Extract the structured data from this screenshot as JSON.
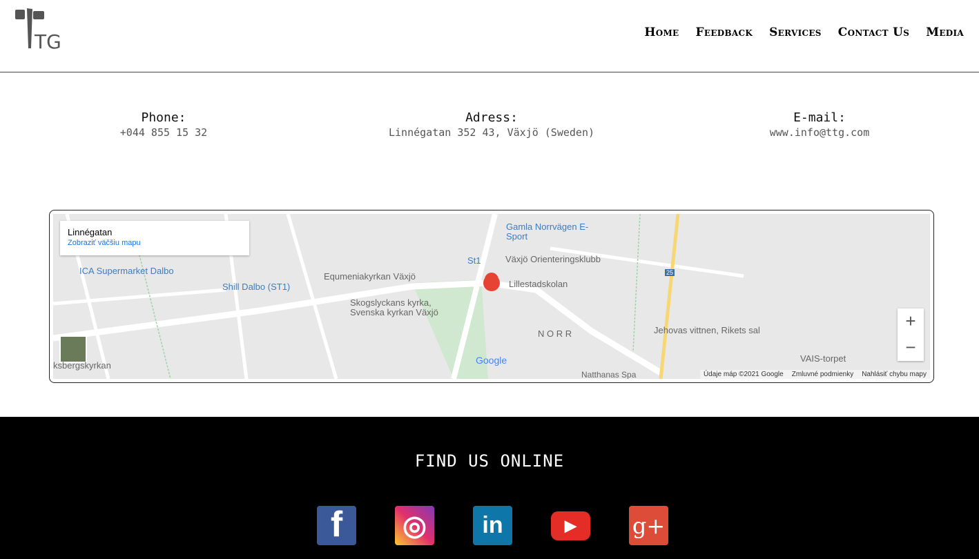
{
  "header": {
    "logo_text": "TG",
    "nav": [
      "Home",
      "Feedback",
      "Services",
      "Contact Us",
      "Media"
    ]
  },
  "contact": {
    "phone": {
      "label": "Phone:",
      "value": "+044 855 15 32"
    },
    "address": {
      "label": "Adress:",
      "value": "Linnégatan 352 43, Växjö (Sweden)"
    },
    "email": {
      "label": "E-mail:",
      "value": "www.info@ttg.com"
    }
  },
  "map": {
    "place_name": "Linnégatan",
    "larger_map_link": "Zobraziť väčšiu mapu",
    "labels": {
      "gamla": "Gamla Norrvägen E-Sport",
      "st1": "St1",
      "orient": "Växjö Orienteringsklubb",
      "ica": "ICA Supermarket Dalbo",
      "equm": "Equmeniakyrkan Växjö",
      "shill": "Shill Dalbo (ST1)",
      "lille": "Lillestadskolan",
      "skog": "Skogslyckans kyrka, Svenska kyrkan Växjö",
      "norr": "N O R R",
      "jehov": "Jehovas vittnen, Rikets sal",
      "vais": "VAIS-torpet",
      "kyrkan": "ksbergskyrkan",
      "natt": "Natthanas Spa",
      "google": "Google",
      "road25": "25"
    },
    "zoom_in": "+",
    "zoom_out": "−",
    "attribution": {
      "data": "Údaje máp ©2021 Google",
      "terms": "Zmluvné podmienky",
      "report": "Nahlásiť chybu mapy"
    }
  },
  "footer": {
    "title": "FIND US ONLINE",
    "social": [
      {
        "icon": "facebook-icon",
        "glyph": "f",
        "color": "#3b5998"
      },
      {
        "icon": "instagram-icon",
        "glyph": "◎",
        "color": "#d6249f"
      },
      {
        "icon": "linkedin-icon",
        "glyph": "in",
        "color": "#0e76a8"
      },
      {
        "icon": "youtube-icon",
        "glyph": "▶",
        "color": "#e52d27"
      },
      {
        "icon": "google-plus-icon",
        "glyph": "g+",
        "color": "#dd4b39"
      }
    ]
  }
}
